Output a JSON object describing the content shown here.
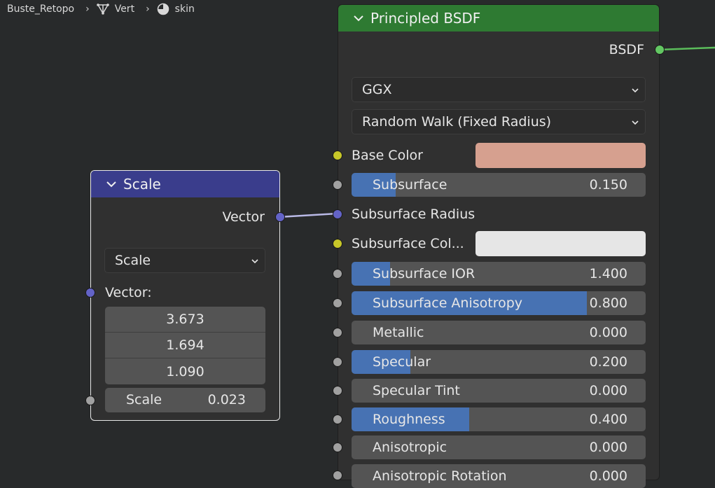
{
  "breadcrumb": {
    "items": [
      {
        "label": "Buste_Retopo",
        "icon": ""
      },
      {
        "label": "Vert",
        "icon": "mesh-data-icon"
      },
      {
        "label": "skin",
        "icon": "material-icon"
      }
    ]
  },
  "scale_node": {
    "title": "Scale",
    "output_label": "Vector",
    "operation": "Scale",
    "input_label": "Vector:",
    "vector_values": [
      "3.673",
      "1.694",
      "1.090"
    ],
    "scale_label": "Scale",
    "scale_value": "0.023",
    "header_color": "#3a3d8c"
  },
  "bsdf_node": {
    "title": "Principled BSDF",
    "output_label": "BSDF",
    "distribution": "GGX",
    "subsurface_method": "Random Walk (Fixed Radius)",
    "header_color": "#2e7a32",
    "base_color": {
      "label": "Base Color",
      "swatch": "#d6a08f"
    },
    "subsurface_radius_label": "Subsurface Radius",
    "subsurface_color": {
      "label": "Subsurface Col...",
      "swatch": "#e6e6e6"
    },
    "sliders": [
      {
        "label": "Subsurface",
        "value": "0.150",
        "fill": 0.15
      },
      {
        "label": "Subsurface IOR",
        "value": "1.400",
        "fill": 0.13
      },
      {
        "label": "Subsurface Anisotropy",
        "value": "0.800",
        "fill": 0.8
      },
      {
        "label": "Metallic",
        "value": "0.000",
        "fill": 0.0
      },
      {
        "label": "Specular",
        "value": "0.200",
        "fill": 0.2
      },
      {
        "label": "Specular Tint",
        "value": "0.000",
        "fill": 0.0
      },
      {
        "label": "Roughness",
        "value": "0.400",
        "fill": 0.4
      },
      {
        "label": "Anisotropic",
        "value": "0.000",
        "fill": 0.0
      },
      {
        "label": "Anisotropic Rotation",
        "value": "0.000",
        "fill": 0.0
      }
    ]
  },
  "colors": {
    "background": "#282a2b",
    "node_body": "#303030",
    "slider_fill": "#4772b3",
    "vector_socket": "#6363c7",
    "float_socket": "#a1a1a1",
    "color_socket": "#c7c729",
    "shader_socket": "#63c763"
  }
}
